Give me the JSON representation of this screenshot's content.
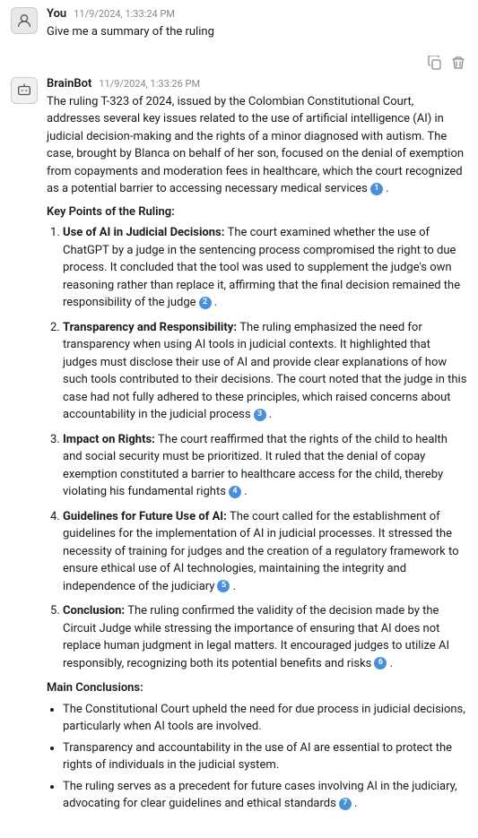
{
  "user": {
    "name": "You",
    "timestamp": "11/9/2024, 1:33:24 PM",
    "message": "Give me a summary of the ruling"
  },
  "bot": {
    "name": "BrainBot",
    "timestamp": "11/9/2024, 1:33:26 PM",
    "intro": "The ruling T-323 of 2024, issued by the Colombian Constitutional Court, addresses several key issues related to the use of artificial intelligence (AI) in judicial decision-making and the rights of a minor diagnosed with autism. The case, brought by Blanca on behalf of her son, focused on the denial of exemption from copayments and moderation fees in healthcare, which the court recognized as a potential barrier to accessing necessary medical services",
    "intro_footnote": "1",
    "key_points_title": "Key Points of the Ruling:",
    "points": [
      {
        "title": "Use of AI in Judicial Decisions",
        "text": "The court examined whether the use of ChatGPT by a judge in the sentencing process compromised the right to due process. It concluded that the tool was used to supplement the judge's own reasoning rather than replace it, affirming that the final decision remained the responsibility of the judge",
        "footnote": "2"
      },
      {
        "title": "Transparency and Responsibility",
        "text": "The ruling emphasized the need for transparency when using AI tools in judicial contexts. It highlighted that judges must disclose their use of AI and provide clear explanations of how such tools contributed to their decisions. The court noted that the judge in this case had not fully adhered to these principles, which raised concerns about accountability in the judicial process",
        "footnote": "3"
      },
      {
        "title": "Impact on Rights",
        "text": "The court reaffirmed that the rights of the child to health and social security must be prioritized. It ruled that the denial of copay exemption constituted a barrier to healthcare access for the child, thereby violating his fundamental rights",
        "footnote": "4"
      },
      {
        "title": "Guidelines for Future Use of AI",
        "text": "The court called for the establishment of guidelines for the implementation of AI in judicial processes. It stressed the necessity of training for judges and the creation of a regulatory framework to ensure ethical use of AI technologies, maintaining the integrity and independence of the judiciary",
        "footnote": "5"
      },
      {
        "title": "Conclusion",
        "text": "The ruling confirmed the validity of the decision made by the Circuit Judge while stressing the importance of ensuring that AI does not replace human judgment in legal matters. It encouraged judges to utilize AI responsibly, recognizing both its potential benefits and risks",
        "footnote": "6"
      }
    ],
    "conclusions_title": "Main Conclusions:",
    "conclusions": [
      "The Constitutional Court upheld the need for due process in judicial decisions, particularly when AI tools are involved.",
      "Transparency and accountability in the use of AI are essential to protect the rights of individuals in the judicial system.",
      "The ruling serves as a precedent for future cases involving AI in the judiciary, advocating for clear guidelines and ethical standards"
    ],
    "last_footnote": "7"
  },
  "actions": {
    "copy_label": "copy",
    "delete_label": "delete"
  }
}
